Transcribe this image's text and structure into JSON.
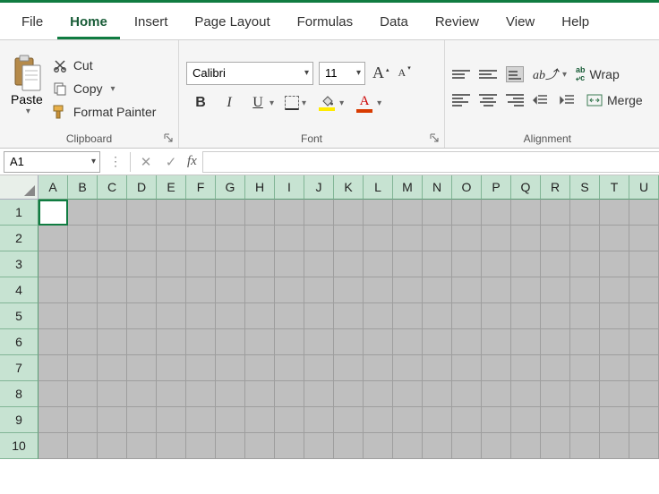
{
  "tabs": {
    "file": "File",
    "home": "Home",
    "insert": "Insert",
    "page_layout": "Page Layout",
    "formulas": "Formulas",
    "data": "Data",
    "review": "Review",
    "view": "View",
    "help": "Help",
    "active": "home"
  },
  "ribbon": {
    "clipboard": {
      "paste": "Paste",
      "cut": "Cut",
      "copy": "Copy",
      "format_painter": "Format Painter",
      "label": "Clipboard"
    },
    "font": {
      "font_name": "Calibri",
      "font_size": "11",
      "label": "Font"
    },
    "alignment": {
      "wrap": "Wrap",
      "merge": "Merge",
      "label": "Alignment"
    }
  },
  "formula_bar": {
    "name_box": "A1",
    "fx": "fx",
    "formula": ""
  },
  "grid": {
    "columns": [
      "A",
      "B",
      "C",
      "D",
      "E",
      "F",
      "G",
      "H",
      "I",
      "J",
      "K",
      "L",
      "M",
      "N",
      "O",
      "P",
      "Q",
      "R",
      "S",
      "T",
      "U"
    ],
    "rows": [
      "1",
      "2",
      "3",
      "4",
      "5",
      "6",
      "7",
      "8",
      "9",
      "10"
    ],
    "active_cell": "A1"
  }
}
